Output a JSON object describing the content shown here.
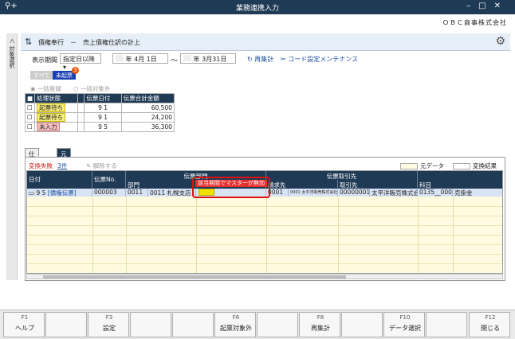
{
  "window": {
    "title": "業務連携入力",
    "company": "ＯＢＣ商事株式会社"
  },
  "side_label": "対象選択",
  "header": {
    "title": "債権奉行　－　売上債権仕訳の計上"
  },
  "period": {
    "label": "表示期間",
    "mode": "指定日以降",
    "from": "年  4月  1日",
    "tilde": "～",
    "to": "年  3月31日"
  },
  "links": {
    "recalc": "再集計",
    "code_maint": "コード設定メンテナンス"
  },
  "status_tabs": {
    "all": "すべて",
    "unstarted": "未起票",
    "badge": "3"
  },
  "options": {
    "bulk": "一括登録",
    "bulk_exclude": "一括対象外"
  },
  "table1": {
    "headers": [
      "処理状態",
      "伝票日付",
      "伝票合計金額"
    ],
    "rows": [
      {
        "status": "起票待ち",
        "date": "9  1",
        "amount": "60,500"
      },
      {
        "status": "起票待ち",
        "date": "9  1",
        "amount": "24,200"
      },
      {
        "status": "未入力",
        "date": "9  5",
        "amount": "36,300"
      }
    ]
  },
  "tabs": [
    "仕訳伝票",
    "元データ"
  ],
  "sub": {
    "fail": "変換失敗",
    "count": "3件",
    "release": "解除する"
  },
  "legend": {
    "source": "元データ",
    "result": "変換結果"
  },
  "grid": {
    "headers": {
      "date": "日付",
      "slip_no": "伝票No.",
      "slip_group": "伝票部門",
      "dept": "部門",
      "partner_group": "伝票取引先",
      "billing": "請求先",
      "partner": "取引先",
      "account": "科目"
    },
    "row": {
      "date": "9  5",
      "slip_link": "[債権伝票]",
      "slip_no": "000003",
      "dept_code": "0011",
      "dept_name": "0011 札幌支店",
      "billing_code": "0001",
      "billing_name": "0001 太平洋販売株式会社",
      "partner_code": "00000001",
      "partner_name": "太平洋販売株式会",
      "account_code": "0135__0000",
      "account_name": "売掛金"
    }
  },
  "popup": {
    "message": "該当期間でマスターが無効"
  },
  "fkeys": [
    {
      "key": "F1",
      "label": "ヘルプ"
    },
    {
      "key": "",
      "label": ""
    },
    {
      "key": "F3",
      "label": "設定"
    },
    {
      "key": "",
      "label": ""
    },
    {
      "key": "",
      "label": ""
    },
    {
      "key": "F6",
      "label": "起票対象外"
    },
    {
      "key": "",
      "label": ""
    },
    {
      "key": "F8",
      "label": "再集計"
    },
    {
      "key": "",
      "label": ""
    },
    {
      "key": "F10",
      "label": "データ選択"
    },
    {
      "key": "",
      "label": ""
    },
    {
      "key": "F12",
      "label": "閉じる"
    }
  ]
}
